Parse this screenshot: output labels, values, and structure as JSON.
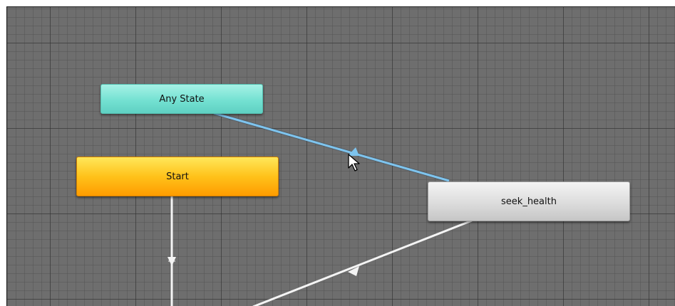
{
  "states": {
    "any_state": {
      "label": "Any State",
      "color": "#74e1d2"
    },
    "start": {
      "label": "Start",
      "color": "#ffb20f"
    },
    "seek_health": {
      "label": "seek_health",
      "color": "#dcdcdc"
    }
  },
  "transitions": [
    {
      "from": "Any State",
      "to": "seek_health",
      "highlighted": true,
      "color": "#7ec4ee"
    },
    {
      "from": "Start",
      "to": "off-screen state",
      "highlighted": false,
      "color": "#f4f4f4"
    },
    {
      "from": "seek_health",
      "to": "off-screen state",
      "highlighted": false,
      "color": "#f4f4f4"
    }
  ],
  "canvas": {
    "background": "#6e6e6e",
    "grid": true
  },
  "cursor": {
    "icon": "arrow-cursor-icon"
  }
}
